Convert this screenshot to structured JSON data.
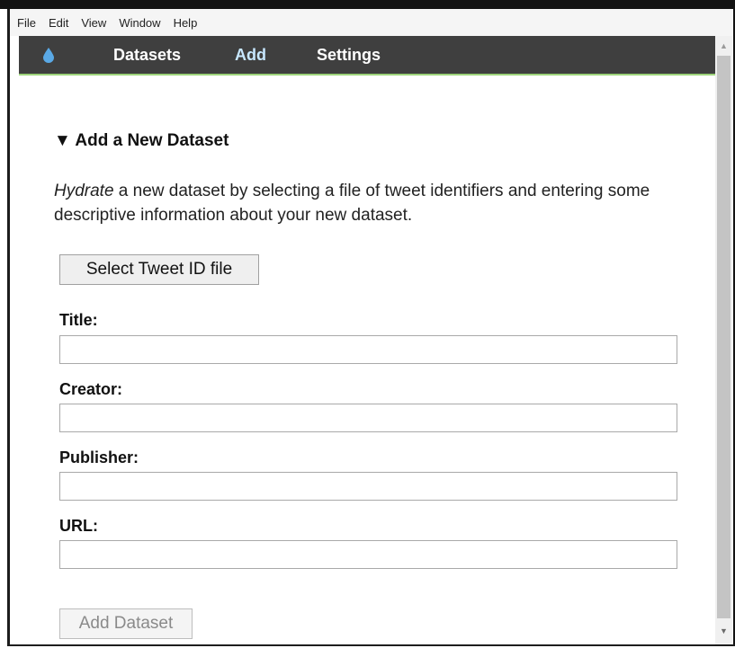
{
  "menu": {
    "items": [
      "File",
      "Edit",
      "View",
      "Window",
      "Help"
    ]
  },
  "nav": {
    "logo_icon": "water-drop-icon",
    "items": [
      "Datasets",
      "Add",
      "Settings"
    ],
    "active": "Add"
  },
  "colors": {
    "nav_bg": "#3f3f3f",
    "nav_active": "#c7e7ff",
    "nav_border": "#9dd37a",
    "drop": "#5aa9e6"
  },
  "add_form": {
    "toggle_icon": "▼",
    "section_title": "Add a New Dataset",
    "intro_em": "Hydrate",
    "intro_rest": " a new dataset by selecting a file of tweet identifiers and entering some descriptive information about your new dataset.",
    "select_button": "Select Tweet ID file",
    "fields": [
      {
        "label": "Title:",
        "value": ""
      },
      {
        "label": "Creator:",
        "value": ""
      },
      {
        "label": "Publisher:",
        "value": ""
      },
      {
        "label": "URL:",
        "value": ""
      }
    ],
    "submit_button": "Add Dataset"
  },
  "scrollbar": {
    "up_icon": "▲",
    "down_icon": "▼"
  }
}
